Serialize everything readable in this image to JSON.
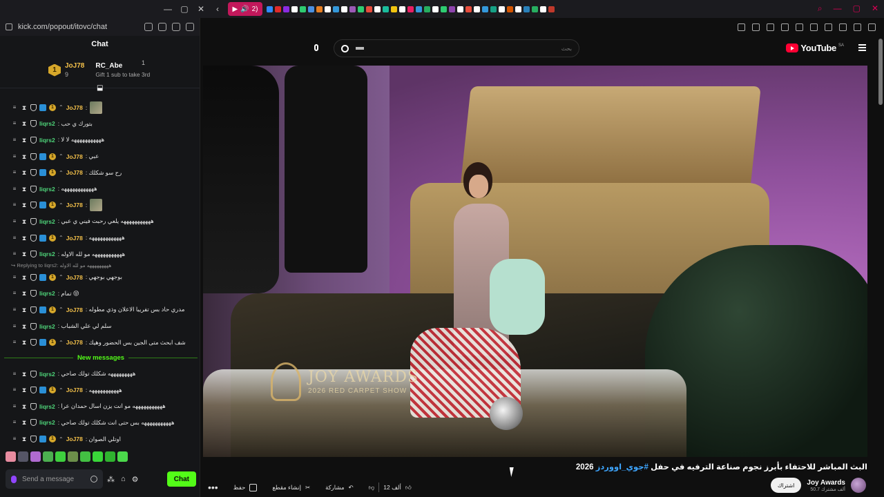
{
  "browser": {
    "tab_audio_label": "2)",
    "tab_colors": [
      "#2d8cff",
      "#e02a2a",
      "#8a2be2",
      "#ffffff",
      "#2ecc71",
      "#4a90e2",
      "#e67e22",
      "#ffffff",
      "#3498db",
      "#ffffff",
      "#9b59b6",
      "#2ecc71",
      "#e74c3c",
      "#ffffff",
      "#1abc9c",
      "#f1c40f",
      "#ffffff",
      "#e91e63",
      "#3498db",
      "#27ae60",
      "#ffffff",
      "#2ecc71",
      "#8e44ad",
      "#ffffff",
      "#e74c3c",
      "#ffffff",
      "#3498db",
      "#16a085",
      "#ffffff",
      "#d35400",
      "#ffffff",
      "#2980b9",
      "#27ae60",
      "#ffffff",
      "#c0392b"
    ]
  },
  "kick": {
    "url": "kick.com/popout/itovc/chat",
    "title": "Chat",
    "leaderboard": {
      "rank": "1",
      "top_user": "JoJ78",
      "top_count": "9",
      "second_user": "RC_Abe",
      "second_count": "1",
      "gift_text": "Gift 1 sub to take 3rd"
    },
    "messages_before": [
      {
        "user": "JoJ78",
        "type": "joj",
        "text": ":",
        "emote": true
      },
      {
        "user": "Iiqrs2",
        "type": "iiq",
        "text": ": بتورك ي حب"
      },
      {
        "user": "Iiqrs2",
        "type": "iiq",
        "text": ": هههههههههههه لا لا"
      },
      {
        "user": "JoJ78",
        "type": "joj",
        "text": ": عبي"
      },
      {
        "user": "JoJ78",
        "type": "joj",
        "text": ": رح سو شكلك"
      },
      {
        "user": "Iiqrs2",
        "type": "iiq",
        "text": ": ههههههههههههه"
      },
      {
        "user": "JoJ78",
        "type": "joj",
        "text": ":",
        "emote": true
      },
      {
        "user": "Iiqrs2",
        "type": "iiq",
        "text": ": هههههههههههه يلعي رحبت فيني ي عبي"
      },
      {
        "user": "JoJ78",
        "type": "joj",
        "text": ": ههههههههههههه"
      },
      {
        "user": "Iiqrs2",
        "type": "iiq",
        "text": ": هههههههههههه مو لله الاوله"
      }
    ],
    "reply_line": "Replying to Iiqrs2: هههههههههه مو لله الاوله",
    "messages_mid": [
      {
        "user": "JoJ78",
        "type": "joj",
        "text": ": بوجهي بوجهي"
      },
      {
        "user": "Iiqrs2",
        "type": "iiq",
        "text": ": تمام 😝"
      },
      {
        "user": "JoJ78",
        "type": "joj",
        "text": ": مدري حاد بس تفريبا الاعلان وذي مطوله"
      },
      {
        "user": "Iiqrs2",
        "type": "iiq",
        "text": ": سلم لي علي الشباب"
      },
      {
        "user": "JoJ78",
        "type": "joj",
        "text": ": شف ابحث متى الجين بس الحضور وهيك"
      }
    ],
    "new_messages_label": "New messages",
    "messages_after": [
      {
        "user": "Iiqrs2",
        "type": "iiq",
        "text": ": هههههههههه شكلك تولك صاحي"
      },
      {
        "user": "JoJ78",
        "type": "joj",
        "text": ": هههههههههههه"
      },
      {
        "user": "Iiqrs2",
        "type": "iiq",
        "text": ": هههههههههههه مو انت يزن اسال حمدان عرا"
      },
      {
        "user": "Iiqrs2",
        "type": "iiq",
        "text": ": هههههههههههه بس حتى انت شكلك تولك صاحي"
      },
      {
        "user": "JoJ78",
        "type": "joj",
        "text": ": اوتلي الصوان"
      }
    ],
    "emote_colors": [
      "#e88ca0",
      "#555566",
      "#b06bd0",
      "#4caf50",
      "#3ecf3e",
      "#6c8f4a",
      "#43c043",
      "#39d639",
      "#2fb32f",
      "#4bd84b"
    ],
    "input_placeholder": "Send a message",
    "chat_button": "Chat"
  },
  "youtube": {
    "search_placeholder": "بحث",
    "logo_text": "YouTube",
    "country": "SA",
    "watermark_line1": "JOY AWARDS",
    "watermark_line2": "2026 RED CARPET SHOW",
    "title_main": "البث المباشر للاحتفاء بأبرز نجوم صناعة الترفيه في حفل",
    "title_hashtag": "#جوي_اووردز",
    "title_year": "2026",
    "actions": {
      "more": "•••",
      "save": "حفظ",
      "clip": "إنشاء مقطع",
      "share": "مشاركة",
      "likes": "12 ألف"
    },
    "channel_name": "Joy Awards",
    "channel_subs": "50.7 ألف مشترك",
    "subscribe": "اشتراك"
  }
}
